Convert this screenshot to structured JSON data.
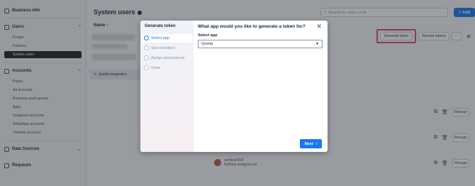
{
  "sidebar": {
    "business_info": "Business info",
    "users_header": "Users",
    "users_items": [
      "People",
      "Partners",
      "System users"
    ],
    "accounts_header": "Accounts",
    "accounts_items": [
      "Pages",
      "Ad accounts",
      "Business asset groups",
      "Apps",
      "Instagram accounts",
      "WhatsApp accounts",
      "Threads accounts"
    ],
    "data_sources": "Data Sources",
    "requests": "Requests"
  },
  "main": {
    "title": "System users",
    "search_placeholder": "Search by name or ID",
    "add_label": "+ Add",
    "col_name": "Name ↑",
    "integration_label": "Quinta integration",
    "generate_token": "Generate token",
    "revoke_tokens": "Revoke tokens",
    "more": "···",
    "manage": "Manage",
    "user_name": "ozcklesf/200",
    "user_status": "Nothing assigned yet"
  },
  "modal": {
    "steps_title": "Generate token",
    "steps": [
      "Select app",
      "Set expiration",
      "Assign permissions",
      "Done"
    ],
    "question": "What app would you like to generate a token for?",
    "select_label": "Select app",
    "selected_app": "Quinta",
    "next_label": "Next"
  },
  "colors": {
    "accent": "#1877f2",
    "highlight": "#e0456b"
  }
}
